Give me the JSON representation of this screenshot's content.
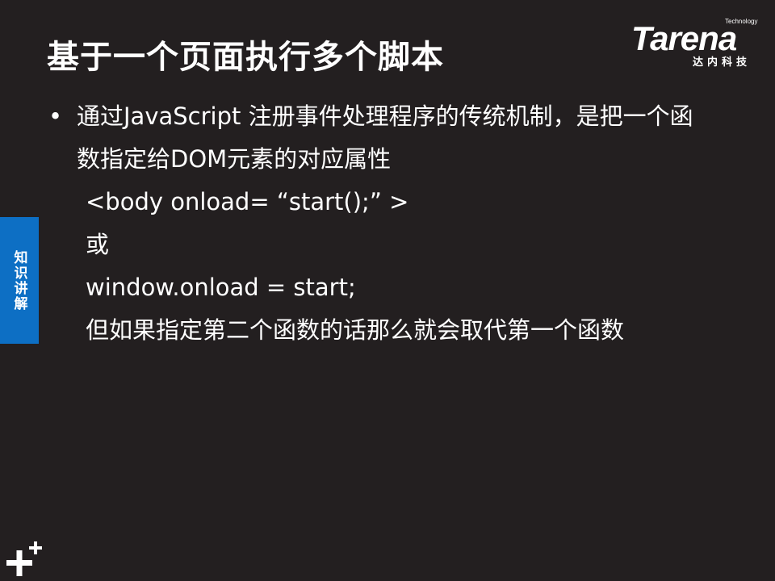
{
  "slide": {
    "title": "基于一个页面执行多个脚本",
    "bullet_text": "通过JavaScript 注册事件处理程序的传统机制，是把一个函数指定给DOM元素的对应属性",
    "lines": [
      " <body onload= “start();” >",
      "或",
      "window.onload = start;",
      "但如果指定第二个函数的话那么就会取代第一个函数"
    ]
  },
  "logo": {
    "tagline": "Technology",
    "wordmark": "Tarena",
    "cn_name": "达内科技"
  },
  "side_tab": {
    "label": "知识讲解"
  },
  "colors": {
    "background": "#231f20",
    "accent": "#0d6fc4",
    "text": "#ffffff"
  },
  "icons": {
    "bullet": "•",
    "corner": "plus-icon"
  }
}
